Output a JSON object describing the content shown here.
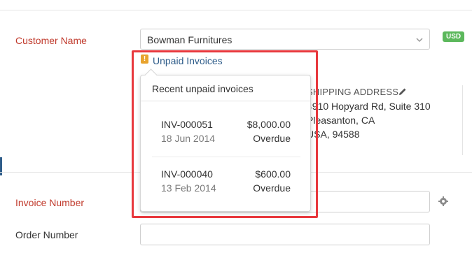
{
  "form": {
    "customer_label": "Customer Name",
    "customer_value": "Bowman Furnitures",
    "currency_badge": "USD",
    "unpaid_link": "Unpaid Invoices",
    "invoice_number_label": "Invoice Number",
    "order_number_label": "Order Number",
    "invoice_number_value": "",
    "order_number_value": ""
  },
  "shipping": {
    "title": "SHIPPING ADDRESS",
    "lines": [
      "4910 Hopyard Rd, Suite 310",
      "Pleasanton, CA",
      "USA, 94588"
    ]
  },
  "popover": {
    "title": "Recent unpaid invoices",
    "invoices": [
      {
        "number": "INV-000051",
        "amount": "$8,000.00",
        "date": "18 Jun 2014",
        "status": "Overdue"
      },
      {
        "number": "INV-000040",
        "amount": "$600.00",
        "date": "13 Feb 2014",
        "status": "Overdue"
      }
    ]
  },
  "icons": {
    "select_chevron": "chevron-down-icon",
    "warning": "warning-icon",
    "edit": "pencil-icon",
    "settings": "gear-icon"
  },
  "colors": {
    "required_label": "#c0392b",
    "link": "#2f5d8a",
    "badge": "#5cb85c",
    "highlight": "#e8383d",
    "warning": "#e8a32e"
  }
}
